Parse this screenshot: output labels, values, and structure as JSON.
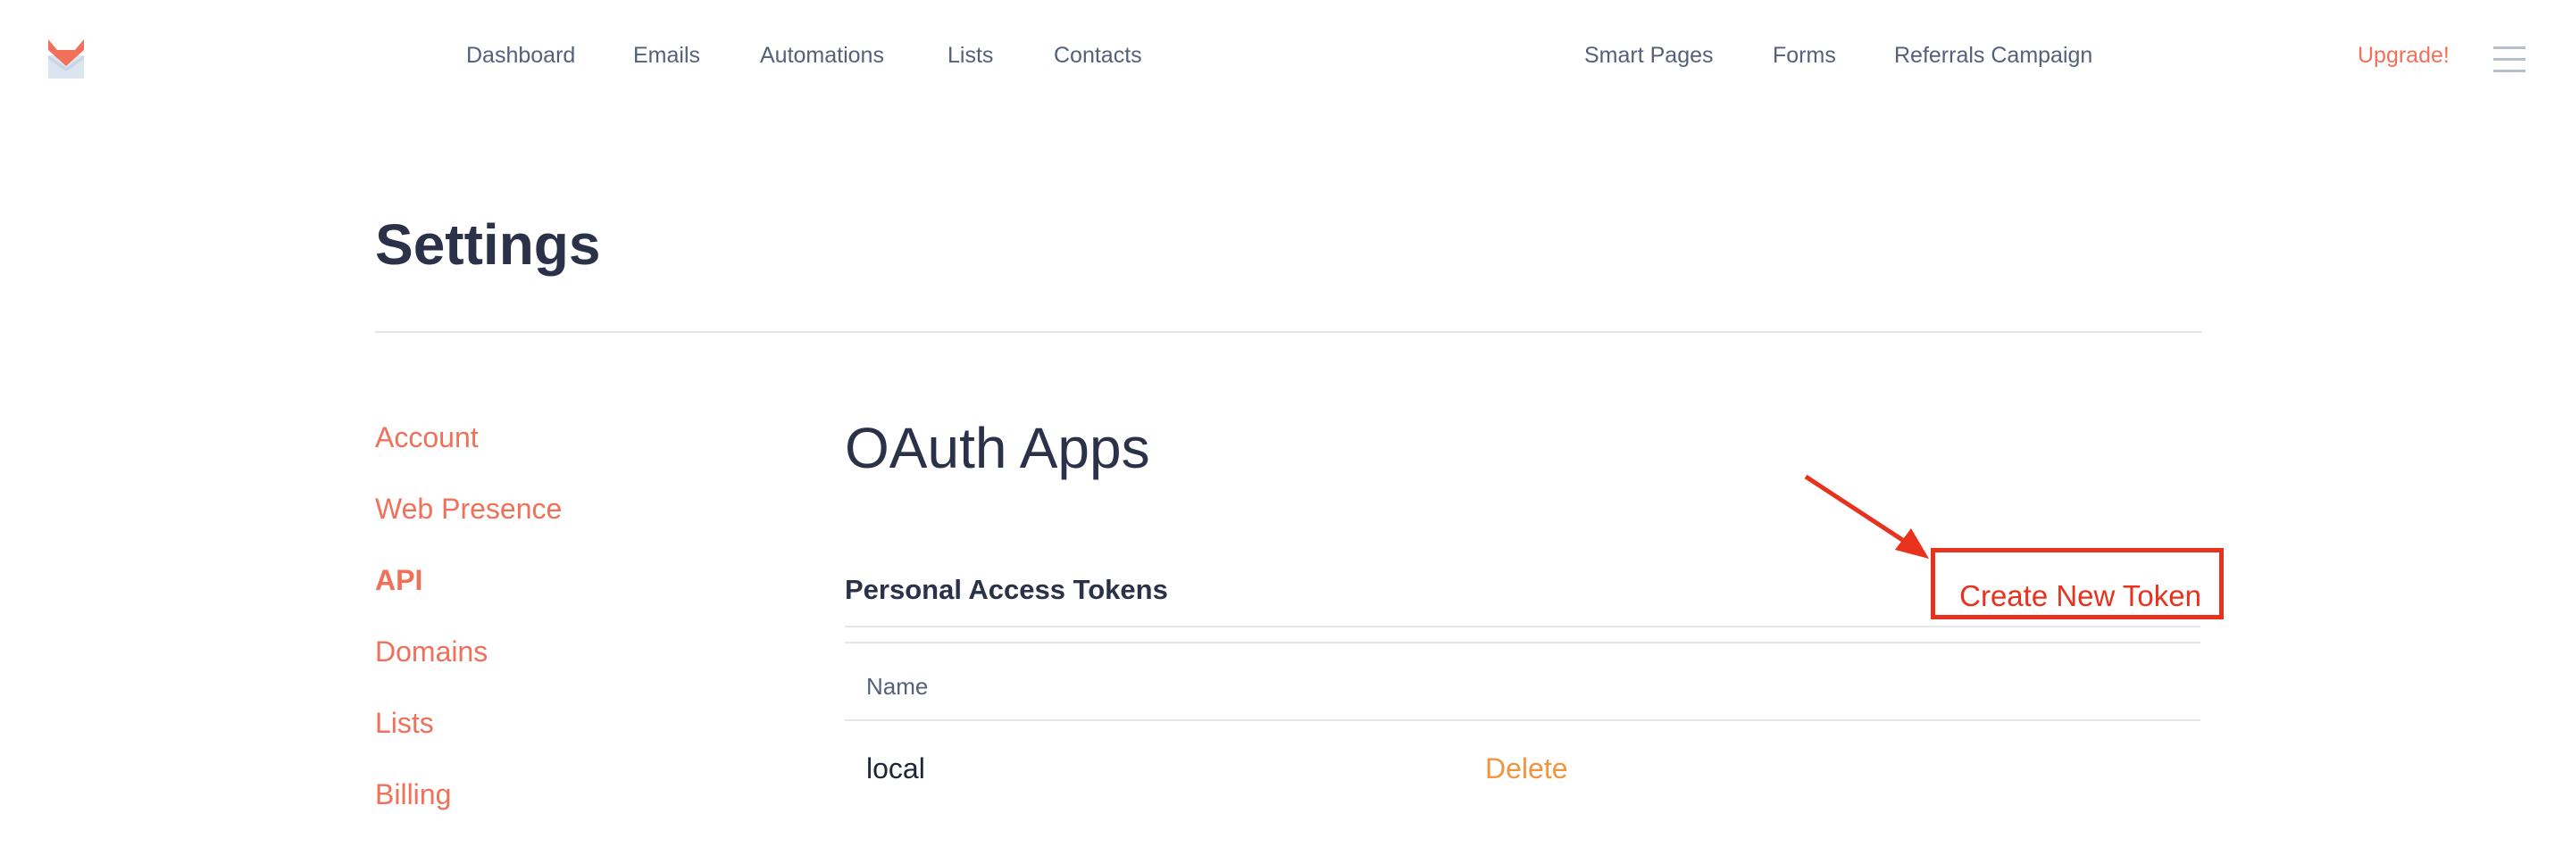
{
  "nav": {
    "left_links": [
      "Dashboard",
      "Emails",
      "Automations",
      "Lists",
      "Contacts"
    ],
    "right_links": [
      "Smart Pages",
      "Forms",
      "Referrals Campaign"
    ],
    "upgrade_label": "Upgrade!"
  },
  "page": {
    "title": "Settings"
  },
  "sidebar": {
    "items": [
      {
        "label": "Account",
        "active": false
      },
      {
        "label": "Web Presence",
        "active": false
      },
      {
        "label": "API",
        "active": true
      },
      {
        "label": "Domains",
        "active": false
      },
      {
        "label": "Lists",
        "active": false
      },
      {
        "label": "Billing",
        "active": false
      }
    ]
  },
  "main": {
    "section_title": "OAuth Apps",
    "tokens_heading": "Personal Access Tokens",
    "create_button_label": "Create New Token",
    "table": {
      "columns": [
        "Name"
      ],
      "rows": [
        {
          "name": "local",
          "action": "Delete"
        }
      ]
    }
  },
  "colors": {
    "accent": "#f0705a",
    "annotation_red": "#e8321e",
    "delete_orange": "#f0963f",
    "heading": "#2b3148"
  }
}
